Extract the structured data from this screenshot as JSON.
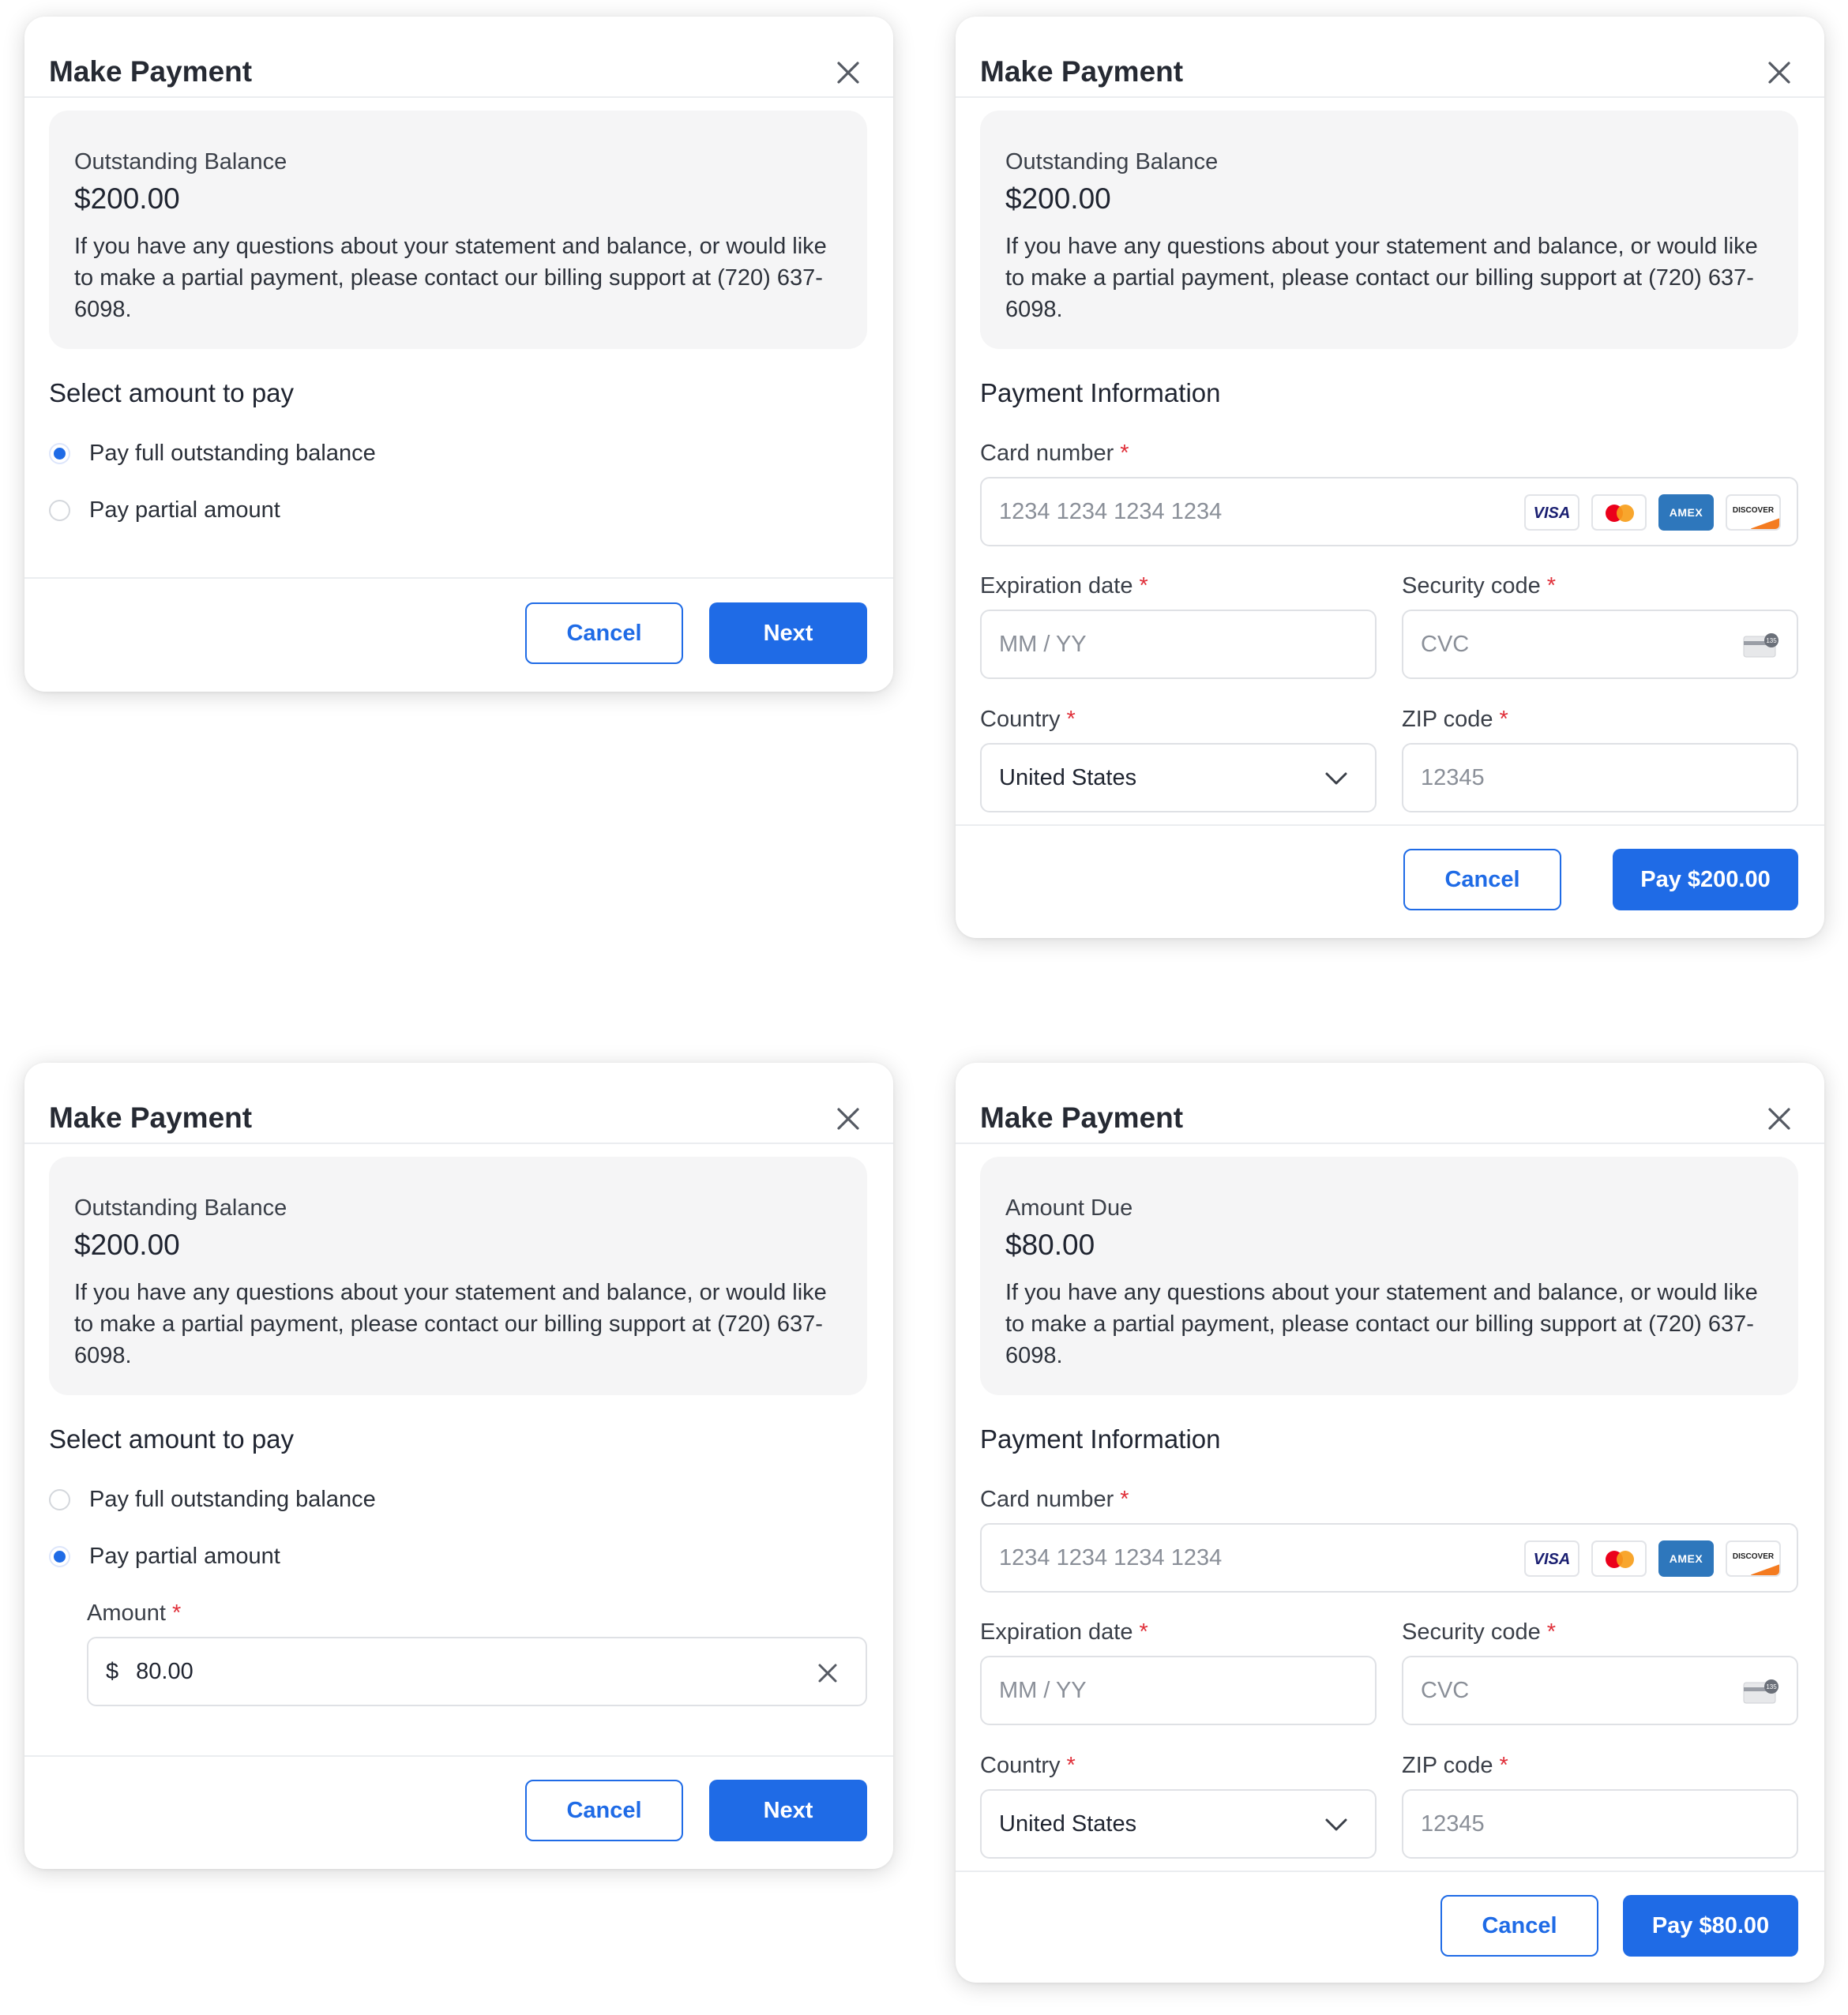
{
  "modals": [
    {
      "title": "Make Payment",
      "balance_label": "Outstanding Balance",
      "balance_amount": "$200.00",
      "note": "If you have any questions about your statement and balance, or would like to make a partial payment, please contact our billing support at (720) 637-6098.",
      "section_title": "Select amount to pay",
      "options": [
        "Pay full outstanding balance",
        "Pay partial amount"
      ],
      "selected_option": 0,
      "cancel_label": "Cancel",
      "primary_label": "Next"
    },
    {
      "title": "Make Payment",
      "balance_label": "Outstanding Balance",
      "balance_amount": "$200.00",
      "note": "If you have any questions about your statement and balance, or would like to make a partial payment, please contact our billing support at (720) 637-6098.",
      "section_title": "Payment Information",
      "card_number_label": "Card number",
      "card_number_placeholder": "1234 1234 1234 1234",
      "expiration_label": "Expiration date",
      "expiration_placeholder": "MM / YY",
      "security_label": "Security code",
      "security_placeholder": "CVC",
      "country_label": "Country",
      "country_value": "United States",
      "zip_label": "ZIP code",
      "zip_placeholder": "12345",
      "cancel_label": "Cancel",
      "primary_label": "Pay $200.00"
    },
    {
      "title": "Make Payment",
      "balance_label": "Outstanding Balance",
      "balance_amount": "$200.00",
      "note": "If you have any questions about your statement and balance, or would like to make a partial payment, please contact our billing support at (720) 637-6098.",
      "section_title": "Select amount to pay",
      "options": [
        "Pay full outstanding balance",
        "Pay partial amount"
      ],
      "selected_option": 1,
      "amount_label": "Amount",
      "amount_currency": "$",
      "amount_value": "80.00",
      "cancel_label": "Cancel",
      "primary_label": "Next"
    },
    {
      "title": "Make Payment",
      "balance_label": "Amount Due",
      "balance_amount": "$80.00",
      "note": "If you have any questions about your statement and balance, or would like to make a partial payment, please contact our billing support at (720) 637-6098.",
      "section_title": "Payment Information",
      "card_number_label": "Card number",
      "card_number_placeholder": "1234 1234 1234 1234",
      "expiration_label": "Expiration date",
      "expiration_placeholder": "MM / YY",
      "security_label": "Security code",
      "security_placeholder": "CVC",
      "country_label": "Country",
      "country_value": "United States",
      "zip_label": "ZIP code",
      "zip_placeholder": "12345",
      "cancel_label": "Cancel",
      "primary_label": "Pay $80.00"
    }
  ],
  "card_brands": [
    "VISA",
    "Mastercard",
    "AMEX",
    "DISCOVER"
  ],
  "required_marker": "*",
  "cvc_icon_text": "135",
  "colors": {
    "accent": "#1f6be6",
    "required": "#e0303a",
    "info_bg": "#f5f5f6"
  }
}
